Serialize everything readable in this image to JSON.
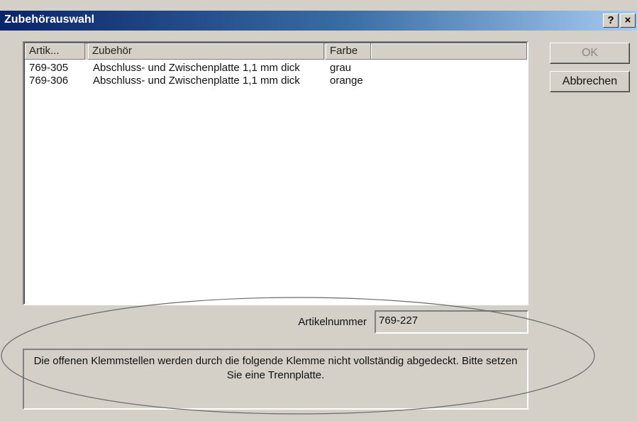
{
  "window": {
    "title": "Zubehörauswahl",
    "help_label": "?",
    "close_label": "×"
  },
  "list": {
    "columns": [
      "Artik...",
      "Zubehör",
      "Farbe"
    ],
    "rows": [
      [
        "769-305",
        "Abschluss- und Zwischenplatte 1,1 mm dick",
        "grau"
      ],
      [
        "769-306",
        "Abschluss- und Zwischenplatte 1,1 mm dick",
        "orange"
      ]
    ]
  },
  "buttons": {
    "ok_label": "OK",
    "cancel_label": "Abbrechen"
  },
  "article_number": {
    "label": "Artikelnummer",
    "value": "769-227"
  },
  "message": {
    "text": "Die offenen Klemmstellen werden durch die folgende Klemme nicht vollständig abgedeckt. Bitte setzen Sie eine Trennplatte."
  },
  "colors": {
    "title_gradient_start": "#0a246a",
    "title_gradient_end": "#a6caf0",
    "dialog_background": "#d4d0c8"
  }
}
